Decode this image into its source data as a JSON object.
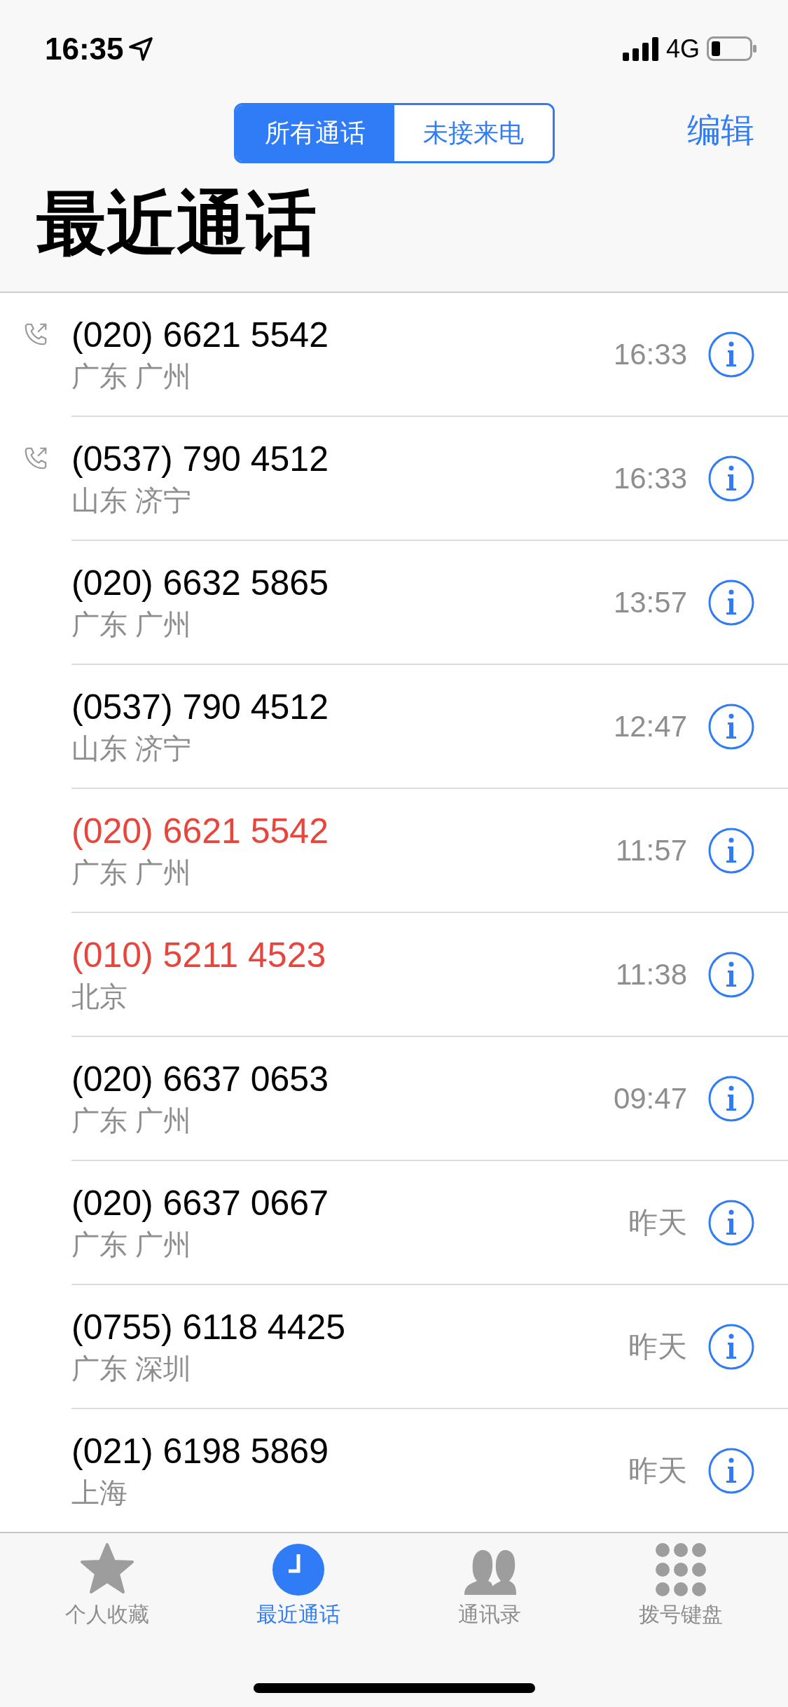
{
  "status_bar": {
    "time": "16:35",
    "network": "4G"
  },
  "segments": [
    {
      "label": "所有通话",
      "selected": true
    },
    {
      "label": "未接来电",
      "selected": false
    }
  ],
  "edit_button": "编辑",
  "title": "最近通话",
  "calls": [
    {
      "number": "(020) 6621 5542",
      "location": "广东 广州",
      "time": "16:33",
      "outgoing": true,
      "missed": false
    },
    {
      "number": "(0537) 790 4512",
      "location": "山东 济宁",
      "time": "16:33",
      "outgoing": true,
      "missed": false
    },
    {
      "number": "(020) 6632 5865",
      "location": "广东 广州",
      "time": "13:57",
      "outgoing": false,
      "missed": false
    },
    {
      "number": "(0537) 790 4512",
      "location": "山东 济宁",
      "time": "12:47",
      "outgoing": false,
      "missed": false
    },
    {
      "number": "(020) 6621 5542",
      "location": "广东 广州",
      "time": "11:57",
      "outgoing": false,
      "missed": true
    },
    {
      "number": "(010) 5211 4523",
      "location": "北京",
      "time": "11:38",
      "outgoing": false,
      "missed": true
    },
    {
      "number": "(020) 6637 0653",
      "location": "广东 广州",
      "time": "09:47",
      "outgoing": false,
      "missed": false
    },
    {
      "number": "(020) 6637 0667",
      "location": "广东 广州",
      "time": "昨天",
      "outgoing": false,
      "missed": false
    },
    {
      "number": "(0755) 6118 4425",
      "location": "广东 深圳",
      "time": "昨天",
      "outgoing": false,
      "missed": false
    },
    {
      "number": "(021) 6198 5869",
      "location": "上海",
      "time": "昨天",
      "outgoing": false,
      "missed": false
    }
  ],
  "tabs": [
    {
      "label": "个人收藏",
      "kind": "favorites",
      "selected": false
    },
    {
      "label": "最近通话",
      "kind": "recents",
      "selected": true
    },
    {
      "label": "通讯录",
      "kind": "contacts",
      "selected": false
    },
    {
      "label": "拨号键盘",
      "kind": "keypad",
      "selected": false
    }
  ]
}
